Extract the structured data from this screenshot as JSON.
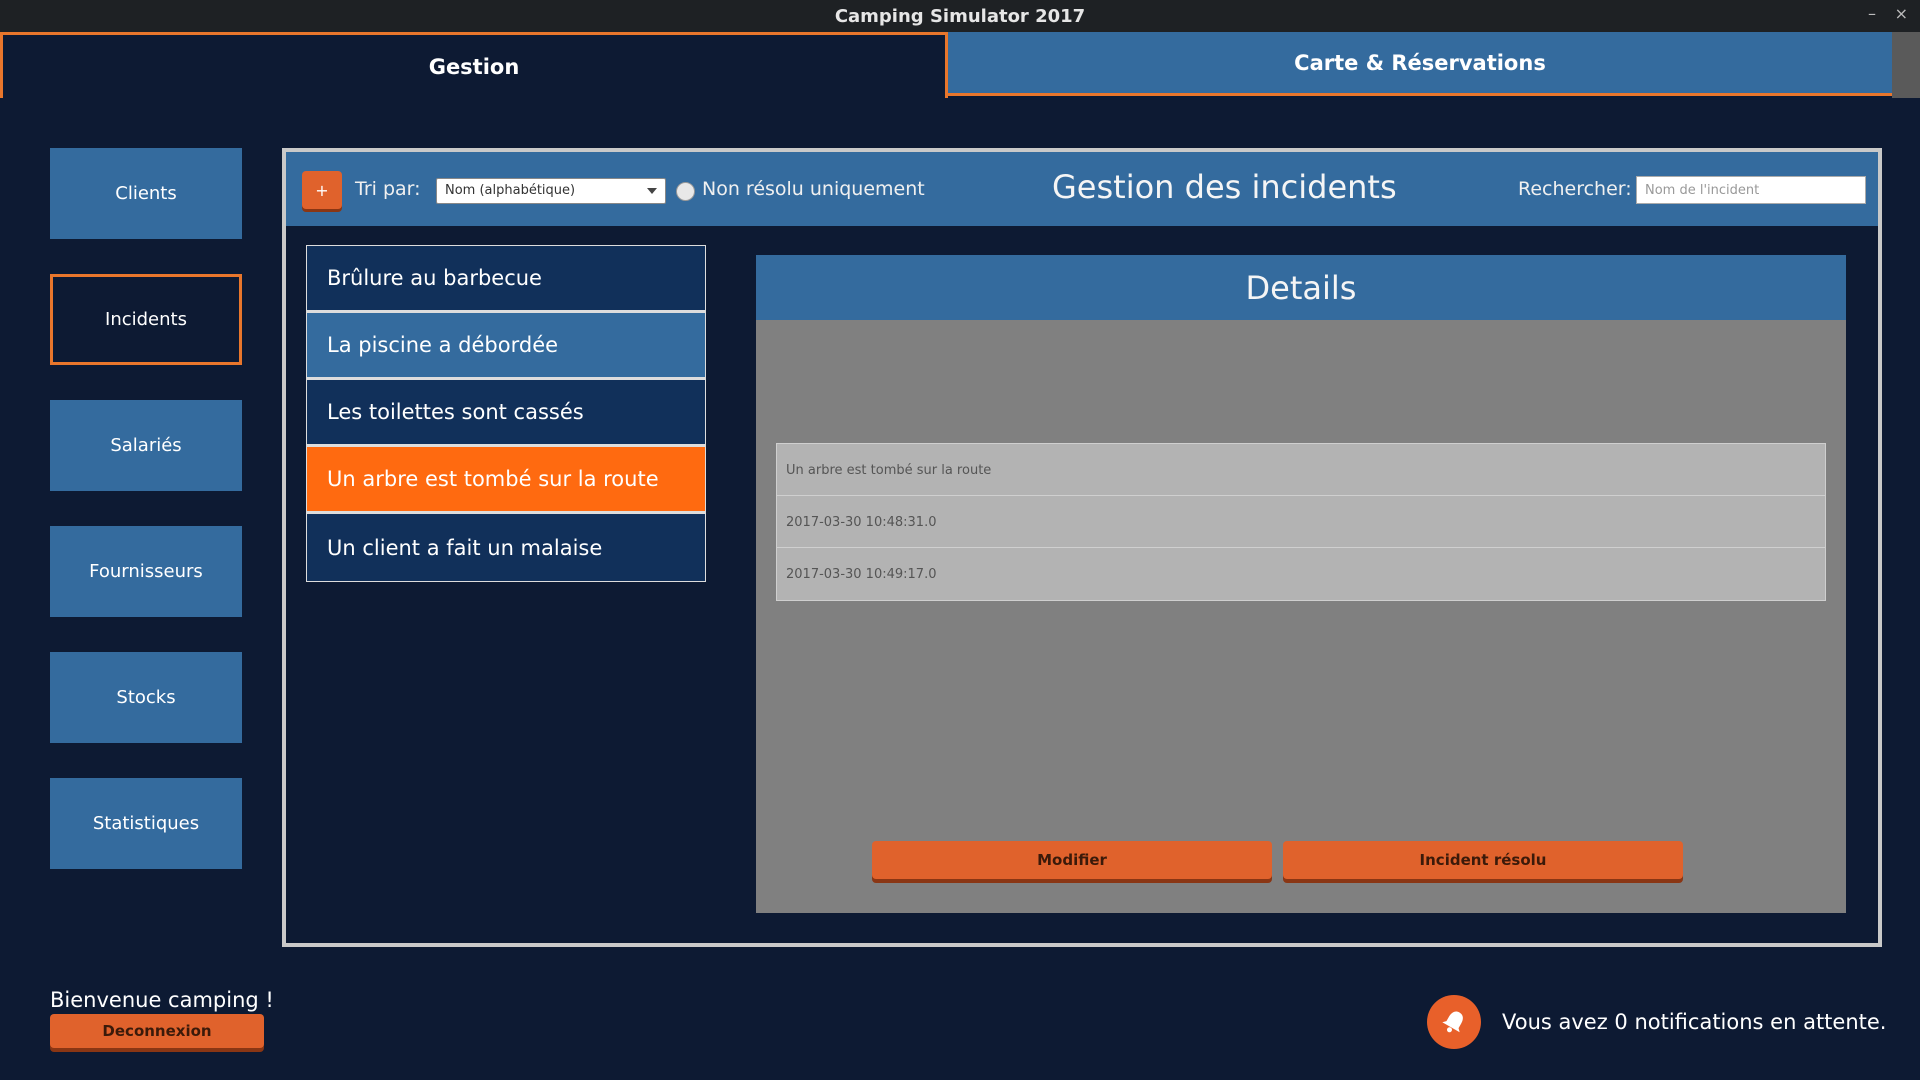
{
  "window": {
    "title": "Camping Simulator 2017",
    "minimize": "–",
    "close": "×"
  },
  "tabs": [
    {
      "label": "Gestion"
    },
    {
      "label": "Carte & Réservations"
    }
  ],
  "sidebar": {
    "items": [
      {
        "label": "Clients"
      },
      {
        "label": "Incidents"
      },
      {
        "label": "Salariés"
      },
      {
        "label": "Fournisseurs"
      },
      {
        "label": "Stocks"
      },
      {
        "label": "Statistiques"
      }
    ]
  },
  "toolbar": {
    "add_label": "+",
    "sort_label": "Tri par:",
    "sort_value": "Nom (alphabétique)",
    "filter_label": "Non résolu uniquement",
    "title": "Gestion des incidents",
    "search_label": "Rechercher:",
    "search_placeholder": "Nom de l'incident"
  },
  "incidents": [
    {
      "label": "Brûlure au barbecue"
    },
    {
      "label": "La piscine a débordée"
    },
    {
      "label": "Les toilettes sont cassés"
    },
    {
      "label": "Un arbre est tombé sur la route"
    },
    {
      "label": "Un client a fait un malaise"
    }
  ],
  "details": {
    "title": "Details",
    "name": "Un arbre est tombé sur la route",
    "created": "2017-03-30 10:48:31.0",
    "resolved": "2017-03-30 10:49:17.0",
    "edit_label": "Modifier",
    "resolve_label": "Incident résolu"
  },
  "footer": {
    "welcome": "Bienvenue camping !",
    "logout_label": "Deconnexion",
    "notifications": "Vous avez 0 notifications en attente."
  },
  "colors": {
    "accent": "#e8762c",
    "primary": "#346b9e",
    "background": "#0d1a33",
    "selected": "#ff6a10"
  }
}
